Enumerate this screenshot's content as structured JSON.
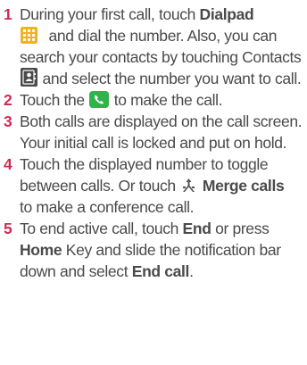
{
  "steps": [
    {
      "number": "1",
      "text_a": "During your first call, touch ",
      "bold_a": "Dialpad",
      "text_b": " and dial the number. Also, you can search your contacts by touching Contacts ",
      "text_c": " and select the number you want to call."
    },
    {
      "number": "2",
      "text_a": "Touch the ",
      "text_b": " to make the call."
    },
    {
      "number": "3",
      "text_a": "Both calls are displayed on the call screen. Your initial call is locked and put on hold."
    },
    {
      "number": "4",
      "text_a": "Touch the displayed number to toggle between calls. Or touch ",
      "bold_a": "Merge calls",
      "text_b": " to make a conference call."
    },
    {
      "number": "5",
      "text_a": "To end active call, touch ",
      "bold_a": "End",
      "text_b": " or press ",
      "bold_b": "Home",
      "text_c": " Key and slide the notification bar down and select ",
      "bold_c": "End call",
      "text_d": "."
    }
  ],
  "icons": {
    "dialpad": "dialpad-icon",
    "contacts": "contacts-icon",
    "call": "phone-call-icon",
    "merge": "merge-calls-icon"
  },
  "colors": {
    "step_number": "#cf2a56",
    "body_text": "#4a4a4a",
    "call_button": "#2fb34a",
    "dialpad_icon": "#f2b21b"
  }
}
